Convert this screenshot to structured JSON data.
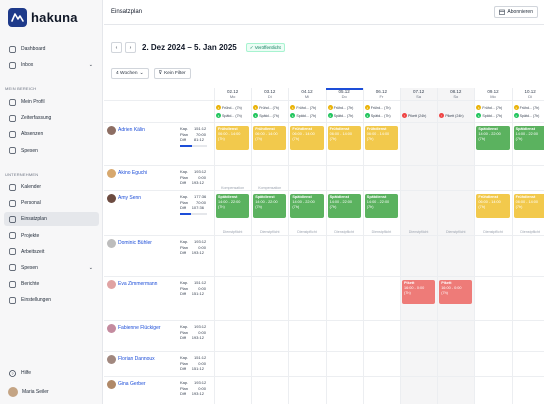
{
  "app": {
    "name": "hakuna"
  },
  "sidebar": {
    "items_top": [
      {
        "label": "Dashboard",
        "icon": "dashboard-icon"
      },
      {
        "label": "Inbox",
        "icon": "inbox-icon",
        "chevron": true
      }
    ],
    "section_mein": "MEIN BEREICH",
    "items_mein": [
      {
        "label": "Mein Profil",
        "icon": "user-icon"
      },
      {
        "label": "Zeiterfassung",
        "icon": "clock-icon"
      },
      {
        "label": "Absenzen",
        "icon": "absence-icon"
      },
      {
        "label": "Spesen",
        "icon": "receipt-icon"
      }
    ],
    "section_unt": "UNTERNEHMEN",
    "items_unt": [
      {
        "label": "Kalender",
        "icon": "calendar-icon"
      },
      {
        "label": "Personal",
        "icon": "people-icon"
      },
      {
        "label": "Einsatzplan",
        "icon": "schedule-icon",
        "active": true
      },
      {
        "label": "Projekte",
        "icon": "folder-icon"
      },
      {
        "label": "Arbeitszeit",
        "icon": "timer-icon"
      },
      {
        "label": "Spesen",
        "icon": "receipt-icon",
        "chevron": true
      },
      {
        "label": "Berichte",
        "icon": "chart-icon"
      },
      {
        "label": "Einstellungen",
        "icon": "gear-icon"
      }
    ],
    "help": "Hilfe",
    "user": "Maria Seiler"
  },
  "header": {
    "title": "Einsatzplan",
    "subscribe": "Abonnieren",
    "range": "2. Dez 2024 – 5. Jan 2025",
    "status": "Veröffentlicht",
    "weeks_filter": "4 Wochen",
    "no_filter": "Kein Filter"
  },
  "days": [
    {
      "date": "02.12",
      "dow": "Mo"
    },
    {
      "date": "03.12",
      "dow": "Di"
    },
    {
      "date": "04.12",
      "dow": "Mi"
    },
    {
      "date": "05.12",
      "dow": "Do"
    },
    {
      "date": "06.12",
      "dow": "Fr"
    },
    {
      "date": "07.12",
      "dow": "Sa"
    },
    {
      "date": "08.12",
      "dow": "So"
    },
    {
      "date": "09.12",
      "dow": "Mo"
    },
    {
      "date": "10.12",
      "dow": "Di"
    }
  ],
  "demand_rows": [
    [
      "Frühd... (7h)",
      "Frühd... (7h)",
      "Frühd... (7h)",
      "Frühd... (7h)",
      "Frühd... (7h)",
      "",
      "",
      "Frühd... (7h)",
      "Frühd... (7h)"
    ],
    [
      "Spätd... (7h)",
      "Spätd... (7h)",
      "Spätd... (7h)",
      "Spätd... (7h)",
      "Spätd... (7h)",
      "Pikett (24h)",
      "Pikett (24h)",
      "Spätd... (7h)",
      "Spätd... (7h)"
    ]
  ],
  "stat_labels": {
    "kap": "Kap.",
    "plan": "Plan",
    "diff": "Diff"
  },
  "employees": [
    {
      "name": "Adrien Kälin",
      "kap": "151:12",
      "plan": "70:00",
      "diff": "81:12",
      "progress": 0.46
    },
    {
      "name": "Akino Eguchi",
      "kap": "193:12",
      "plan": "0:00",
      "diff": "193:12",
      "progress": 0
    },
    {
      "name": "Amy Senn",
      "kap": "177:36",
      "plan": "70:00",
      "diff": "107:36",
      "progress": 0.39
    },
    {
      "name": "Dominic Bühler",
      "kap": "193:12",
      "plan": "0:00",
      "diff": "193:12",
      "progress": 0
    },
    {
      "name": "Eva Zimmermann",
      "kap": "151:12",
      "plan": "0:00",
      "diff": "151:12",
      "progress": 0
    },
    {
      "name": "Fabienne Flückiger",
      "kap": "193:12",
      "plan": "0:00",
      "diff": "193:12",
      "progress": 0
    },
    {
      "name": "Florian Dannoux",
      "kap": "151:12",
      "plan": "0:00",
      "diff": "151:12",
      "progress": 0
    },
    {
      "name": "Gina Gerber",
      "kap": "193:12",
      "plan": "0:00",
      "diff": "193:12",
      "progress": 0
    }
  ],
  "shifts": {
    "fruh": {
      "name": "Frühdienst",
      "time": "06:00 - 14:00",
      "hours": "(7h)"
    },
    "spat": {
      "name": "Spätdienst",
      "time": "14:00 - 22:00",
      "hours": "(7h)"
    },
    "pik": {
      "name": "Pikett",
      "time": "16:00 - 0:00",
      "hours": "(7h)"
    }
  },
  "labels": {
    "kompensation": "Kompensation",
    "dienstpflicht": "Dienstpflicht"
  }
}
